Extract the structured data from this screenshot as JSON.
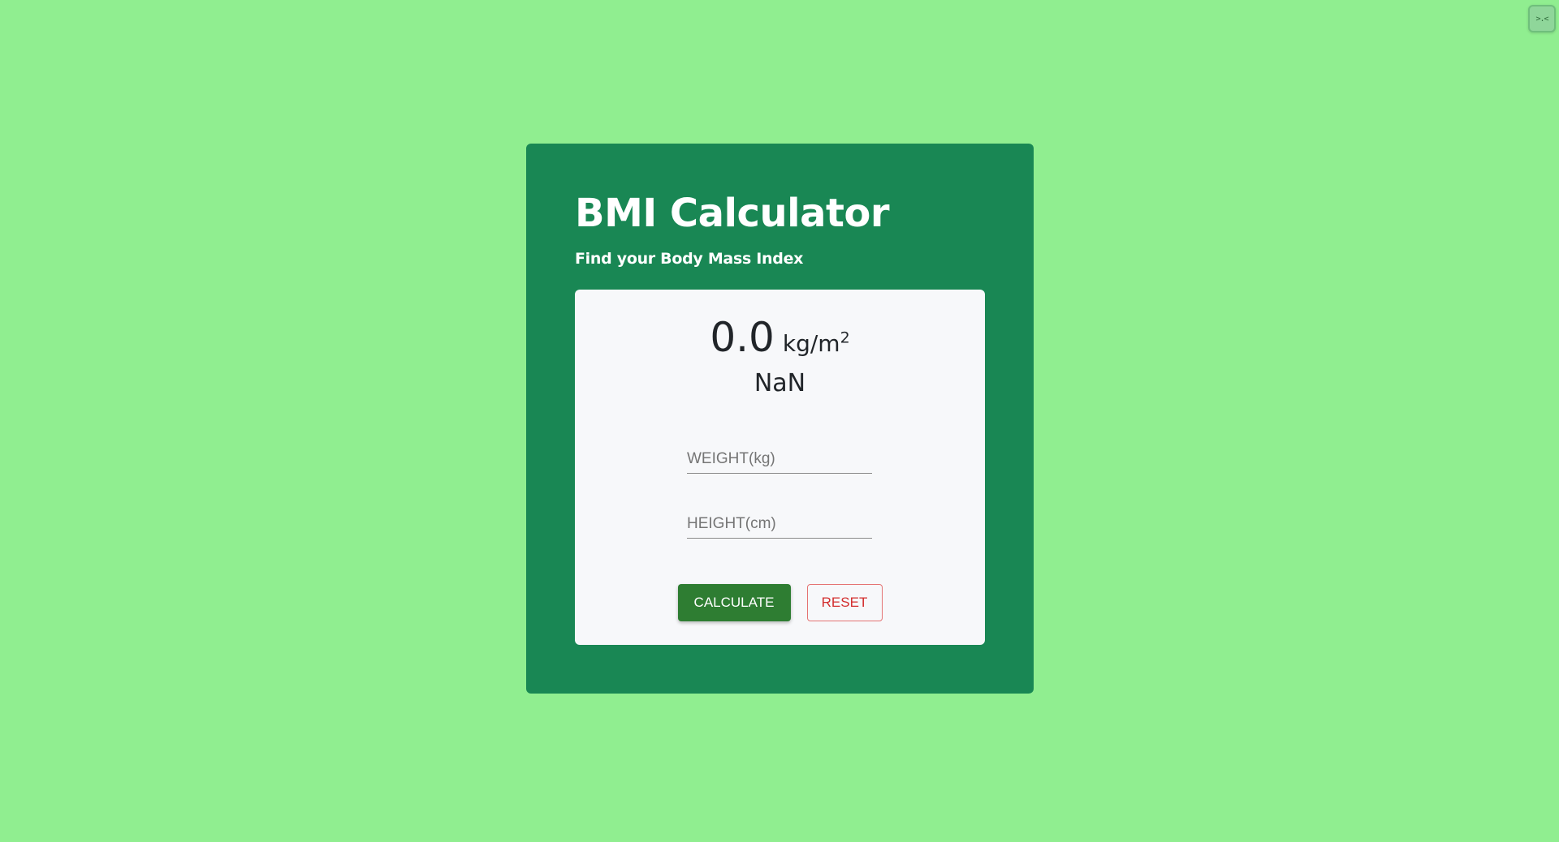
{
  "corner_widget": {
    "glyph": ">.<",
    "icon": "devtools-icon"
  },
  "app": {
    "title": "BMI Calculator",
    "subtitle": "Find your Body Mass Index"
  },
  "result": {
    "value": "0.0",
    "unit": "kg/m",
    "unit_exponent": "2",
    "category": "NaN"
  },
  "form": {
    "weight_placeholder": "WEIGHT(kg)",
    "weight_value": "",
    "height_placeholder": "HEIGHT(cm)",
    "height_value": ""
  },
  "buttons": {
    "calculate_label": "CALCULATE",
    "reset_label": "RESET"
  },
  "colors": {
    "page_background": "#90ee90",
    "card_background": "#198754",
    "panel_background": "#f7f8fa",
    "calculate_button": "#2e7d32",
    "reset_button_text": "#d32f2f"
  }
}
